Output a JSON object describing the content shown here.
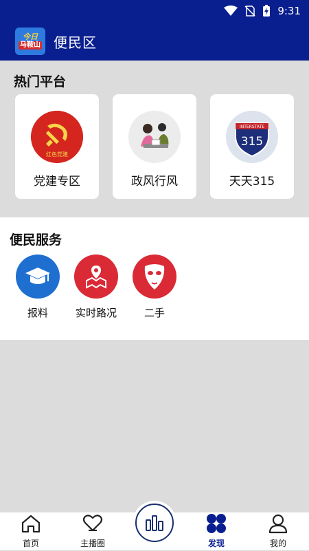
{
  "status_bar": {
    "time": "9:31"
  },
  "header": {
    "logo_line1": "今日",
    "logo_line2": "马鞍山",
    "title": "便民区"
  },
  "hot_platforms": {
    "title": "热门平台",
    "items": [
      {
        "label": "党建专区",
        "icon": "party-emblem-icon",
        "badge_text": "红色党建"
      },
      {
        "label": "政风行风",
        "icon": "government-service-icon"
      },
      {
        "label": "天天315",
        "icon": "interstate-315-sign-icon",
        "sign_top": "INTERSTATE",
        "sign_number": "315"
      }
    ]
  },
  "services": {
    "title": "便民服务",
    "items": [
      {
        "label": "报料",
        "icon": "graduation-cap-icon",
        "color": "#1f6fd1"
      },
      {
        "label": "实时路况",
        "icon": "map-location-icon",
        "color": "#d92a35"
      },
      {
        "label": "二手",
        "icon": "mask-icon",
        "color": "#d92a35"
      }
    ]
  },
  "bottom_nav": {
    "items": [
      {
        "label": "首页",
        "icon": "home-icon"
      },
      {
        "label": "主播圈",
        "icon": "heart-chat-icon"
      },
      {
        "label": "发现",
        "icon": "discover-icon",
        "active": true
      },
      {
        "label": "我的",
        "icon": "profile-icon"
      }
    ],
    "center_icon": "bar-chart-icon"
  },
  "colors": {
    "primary": "#0a1f8f",
    "background": "#dcdcdc",
    "accent_red": "#d92a35",
    "accent_blue": "#1f6fd1"
  }
}
